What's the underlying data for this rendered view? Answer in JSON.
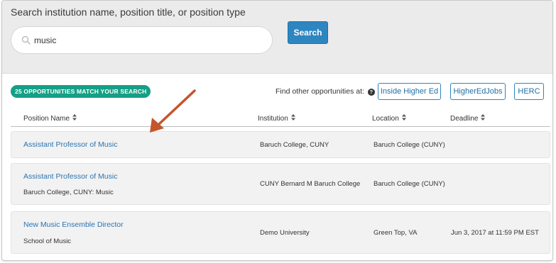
{
  "search": {
    "heading": "Search institution name, position title, or position type",
    "value": "music",
    "placeholder": "",
    "button_label": "Search"
  },
  "results": {
    "count_badge": "25 OPPORTUNITIES MATCH YOUR SEARCH",
    "find_other_label": "Find other opportunities at:",
    "help_glyph": "?",
    "external_sites": [
      {
        "label": "Inside Higher Ed"
      },
      {
        "label": "HigherEdJobs"
      },
      {
        "label": "HERC"
      }
    ]
  },
  "table": {
    "columns": [
      "Position Name",
      "Institution",
      "Location",
      "Deadline"
    ],
    "rows": [
      {
        "position": "Assistant Professor of Music",
        "department": "",
        "institution": "Baruch College, CUNY",
        "location": "Baruch College (CUNY)",
        "deadline": ""
      },
      {
        "position": "Assistant Professor of Music",
        "department": "Baruch College, CUNY: Music",
        "institution": "CUNY Bernard M Baruch College",
        "location": "Baruch College (CUNY)",
        "deadline": ""
      },
      {
        "position": "New Music Ensemble Director",
        "department": "School of Music",
        "institution": "Demo University",
        "location": "Green Top, VA",
        "deadline": "Jun 3, 2017 at 11:59 PM EST"
      }
    ]
  },
  "colors": {
    "accent_blue": "#2e86c1",
    "badge_green": "#14a086",
    "annotation_arrow": "#c4552c"
  },
  "icons": [
    "search-icon",
    "help-icon",
    "sort-icon",
    "annotation-arrow"
  ]
}
